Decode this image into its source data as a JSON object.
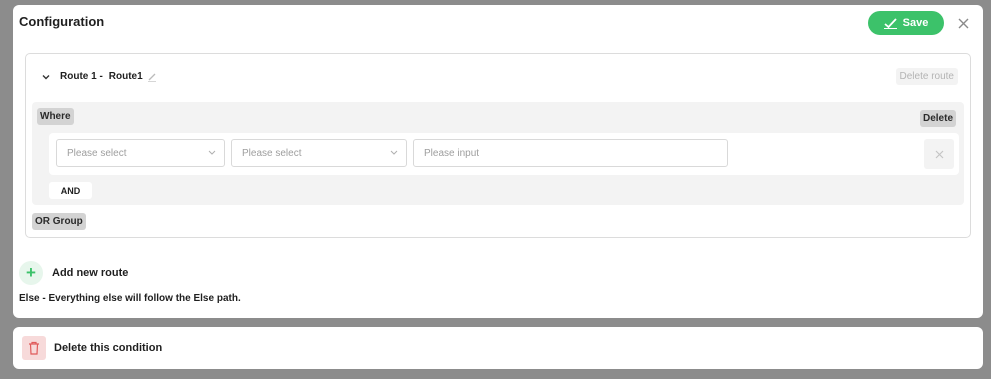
{
  "panel": {
    "title": "Configuration",
    "save_label": "Save",
    "accent_color": "#3cc26a"
  },
  "route": {
    "title": "Route 1 -",
    "name": "Route1",
    "delete_route_label": "Delete route",
    "where_label": "Where",
    "delete_label": "Delete",
    "condition": {
      "select1_placeholder": "Please select",
      "select2_placeholder": "Please select",
      "input_placeholder": "Please input"
    },
    "and_label": "AND",
    "or_group_label": "OR Group"
  },
  "add_route_label": "Add new route",
  "else_text": "Else - Everything else will follow the Else path.",
  "footer": {
    "delete_condition_label": "Delete this condition",
    "danger_color": "#e05a5a"
  }
}
